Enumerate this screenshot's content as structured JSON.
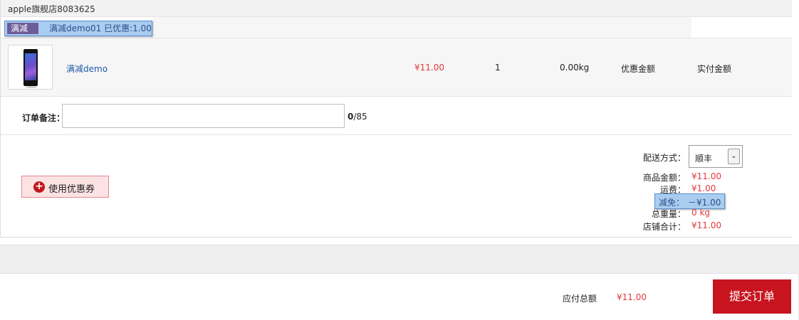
{
  "store": {
    "name": "apple旗舰店8083625"
  },
  "promotion": {
    "tag": "满减",
    "text": "满减demo01 已优惠:1.00"
  },
  "item": {
    "image_icon": "phone-icon",
    "name": "满减demo",
    "price": "¥11.00",
    "quantity": "1",
    "weight": "0.00kg",
    "discount_label": "优惠金额",
    "actual_label": "实付金额"
  },
  "note": {
    "label": "订单备注：",
    "value": "",
    "placeholder": "",
    "count_current": "0",
    "count_max": "/85"
  },
  "coupon": {
    "label": "使用优惠券",
    "icon": "plus-circle-icon"
  },
  "shipping": {
    "label": "配送方式：",
    "selected": "顺丰",
    "arrow_icon": "chevron-down-icon"
  },
  "summary": {
    "goods_label": "商品金额：",
    "goods_value": "¥11.00",
    "freight_label": "运费：",
    "freight_value": "¥1.00",
    "reduce_label": "减免：",
    "reduce_value": "－¥1.00",
    "weight_label": "总重量：",
    "weight_value": "0 kg",
    "store_total_label": "店铺合计：",
    "store_total_value": "¥11.00"
  },
  "footer": {
    "payable_label": "应付总额",
    "payable_value": "¥11.00",
    "submit_label": "提交订单"
  },
  "colors": {
    "accent_red": "#c7141f",
    "price_red": "#e4393c",
    "link_blue": "#1f5ca8",
    "highlight_blue": "#a9cdf0"
  }
}
